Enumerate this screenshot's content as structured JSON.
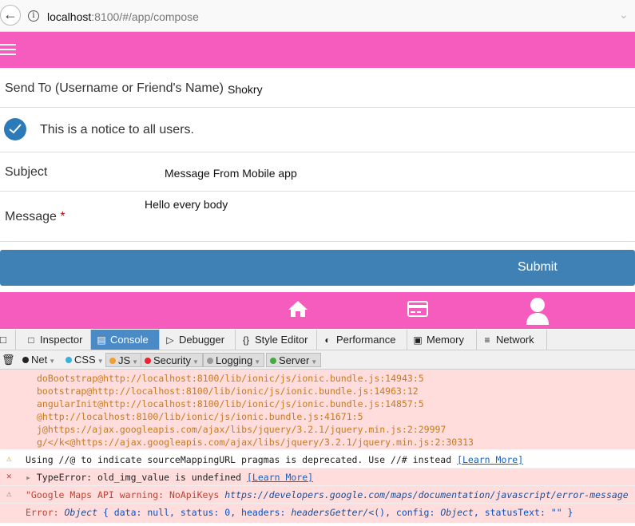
{
  "browser": {
    "url_host": "localhost",
    "url_rest": ":8100/#/app/compose"
  },
  "form": {
    "send_to_label": "Send To (Username or Friend's Name)",
    "send_to_value": "Shokry",
    "notice_label": "This is a notice to all users.",
    "notice_checked": true,
    "subject_label": "Subject",
    "subject_value": "Message From Mobile app",
    "message_label": "Message",
    "message_required_mark": "*",
    "message_value": "Hello every body",
    "submit_label": "Submit"
  },
  "tabbar": {
    "items": [
      "home-icon",
      "card-icon",
      "profile-icon"
    ]
  },
  "colors": {
    "brand_pink": "#f65cbd",
    "submit_blue": "#3f81b5",
    "check_blue": "#2d7ab8"
  },
  "devtools": {
    "tabs": [
      "Inspector",
      "Console",
      "Debugger",
      "Style Editor",
      "Performance",
      "Memory",
      "Network"
    ],
    "active_tab": "Console",
    "filters": [
      "Net",
      "CSS",
      "JS",
      "Security",
      "Logging",
      "Server"
    ]
  },
  "console": {
    "stack": [
      "doBootstrap@http://localhost:8100/lib/ionic/js/ionic.bundle.js:14943:5",
      "bootstrap@http://localhost:8100/lib/ionic/js/ionic.bundle.js:14963:12",
      "angularInit@http://localhost:8100/lib/ionic/js/ionic.bundle.js:14857:5",
      "@http://localhost:8100/lib/ionic/js/ionic.bundle.js:41671:5",
      "j@https://ajax.googleapis.com/ajax/libs/jquery/3.2.1/jquery.min.js:2:29997",
      "g/</k<@https://ajax.googleapis.com/ajax/libs/jquery/3.2.1/jquery.min.js:2:30313"
    ],
    "warning_text": "Using //@ to indicate sourceMappingURL pragmas is deprecated. Use //# instead",
    "learn_more": "[Learn More]",
    "type_error_text": "TypeError: old_img_value is undefined",
    "gmaps_prefix": "\"Google Maps API warning: NoApiKeys ",
    "gmaps_url": "https://developers.google.com/maps/documentation/javascript/error-message",
    "error_label": "Error:",
    "error_obj": "Object",
    "error_body_1": " { data: null, status: 0, headers: ",
    "error_fn": "headersGetter/<",
    "error_body_2": "(), config: ",
    "error_body_3": ", statusText: \"\" }"
  }
}
